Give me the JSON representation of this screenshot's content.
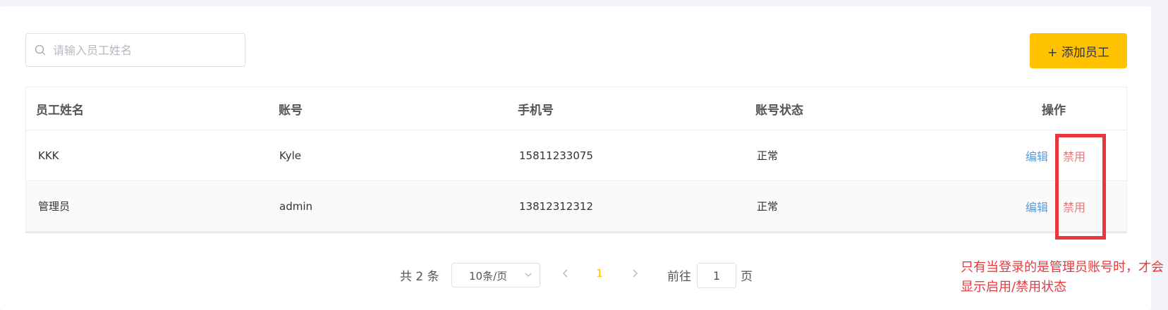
{
  "search": {
    "placeholder": "请输入员工姓名",
    "value": "",
    "icon": "search-icon"
  },
  "toolbar": {
    "add_label": "+ 添加员工"
  },
  "table": {
    "headers": {
      "name": "员工姓名",
      "account": "账号",
      "phone": "手机号",
      "status": "账号状态",
      "ops": "操作"
    },
    "rows": [
      {
        "name": "KKK",
        "account": "Kyle",
        "phone": "15811233075",
        "status": "正常",
        "edit": "编辑",
        "disable": "禁用"
      },
      {
        "name": "管理员",
        "account": "admin",
        "phone": "13812312312",
        "status": "正常",
        "edit": "编辑",
        "disable": "禁用"
      }
    ]
  },
  "annotation": {
    "text": "只有当登录的是管理员账号时，才会显示启用/禁用状态"
  },
  "pagination": {
    "total_label": "共 2 条",
    "page_size": "10条/页",
    "current_page": "1",
    "goto_label": "前往",
    "goto_value": "1",
    "goto_suffix": "页"
  },
  "colors": {
    "accent": "#ffc200",
    "link": "#5b9bd5",
    "danger": "#e07a7a",
    "annotation": "#e8383d"
  }
}
